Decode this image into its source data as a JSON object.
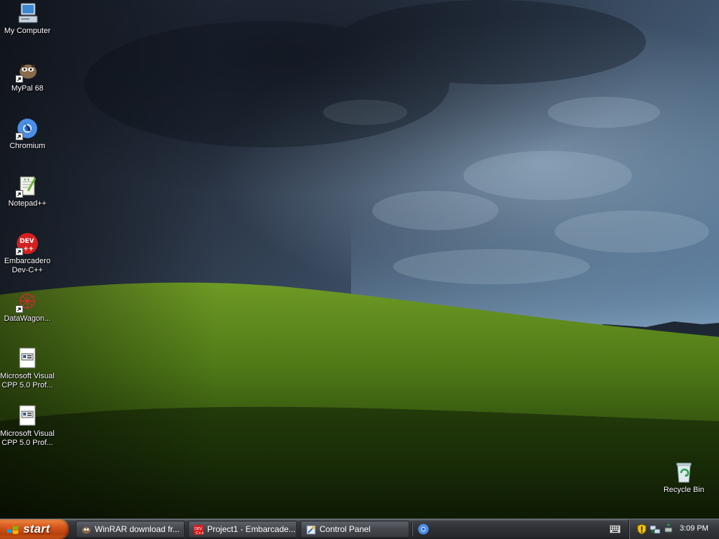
{
  "desktop": {
    "icons": [
      {
        "label": "My Computer",
        "icon": "my-computer-icon",
        "shortcut": false
      },
      {
        "label": "MyPal 68",
        "icon": "mypal-icon",
        "shortcut": true
      },
      {
        "label": "Chromium",
        "icon": "chromium-icon",
        "shortcut": true
      },
      {
        "label": "Notepad++",
        "icon": "notepad-plus-plus-icon",
        "shortcut": true
      },
      {
        "label": "Embarcadero Dev-C++",
        "icon": "devcpp-icon",
        "shortcut": true
      },
      {
        "label": "DataWagon...",
        "icon": "datawagon-icon",
        "shortcut": true
      },
      {
        "label": "Microsoft Visual CPP 5.0 Prof...",
        "icon": "installer-icon",
        "shortcut": false
      },
      {
        "label": "Microsoft Visual CPP 5.0 Prof...",
        "icon": "installer-icon",
        "shortcut": false
      }
    ],
    "recycle_bin": {
      "label": "Recycle Bin",
      "icon": "recycle-bin-icon"
    }
  },
  "taskbar": {
    "start_label": "start",
    "tasks": [
      {
        "label": "WinRAR download fr...",
        "icon": "mypal-icon"
      },
      {
        "label": "Project1 - Embarcade...",
        "icon": "devcpp-icon"
      },
      {
        "label": "Control Panel",
        "icon": "control-panel-icon"
      }
    ],
    "quick_launch": [
      {
        "icon": "chromium-icon"
      }
    ],
    "tray": {
      "icons": [
        "keyboard-icon",
        "security-shield-icon",
        "network-icon",
        "safely-remove-icon"
      ],
      "clock": "3:09 PM"
    }
  },
  "colors": {
    "start_button": "#c8501a",
    "taskbar": "#2e3035",
    "label_text": "#ffffff"
  }
}
